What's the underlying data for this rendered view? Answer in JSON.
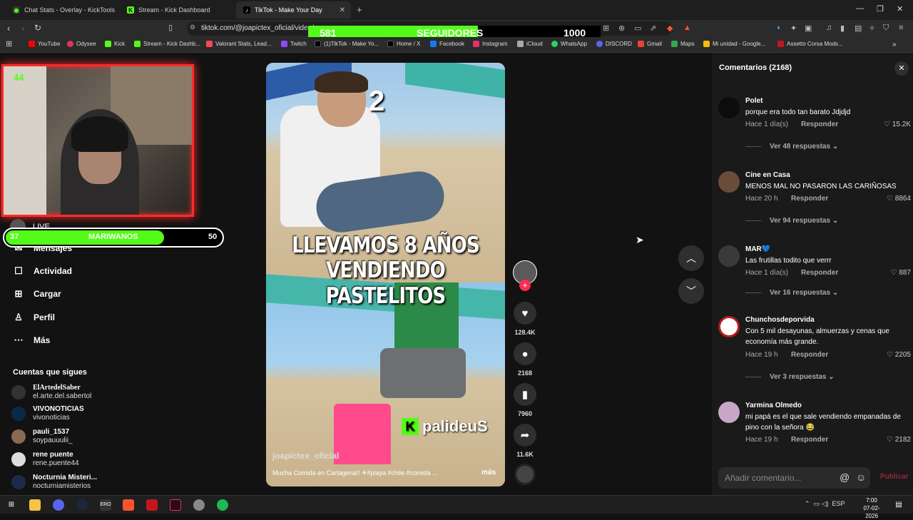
{
  "browser": {
    "tabs": [
      {
        "label": "Chat Stats - Overlay - KickTools",
        "active": false
      },
      {
        "label": "Stream - Kick Dashboard",
        "active": false
      },
      {
        "label": "TikTok - Make Your Day",
        "active": true
      }
    ],
    "url": "tiktok.com/@joapictex_oficial/video/",
    "bookmarks": [
      "YouTube",
      "Odysee",
      "Kick",
      "Stream - Kick Dashb...",
      "Valorant Stats, Lead...",
      "Twitch",
      "(1)TikTok - Make Yo...",
      "Home / X",
      "Facebook",
      "Instagram",
      "iCloud",
      "WhatsApp",
      "DISCORD",
      "Gmail",
      "Maps",
      "Mi unidad - Google...",
      "Assetto Corsa Mods..."
    ]
  },
  "overlay_followers": {
    "current": "581",
    "label": "SEGUIDORES",
    "goal": "1000",
    "progress": 0.58
  },
  "webcam": {
    "count": "44"
  },
  "live_label": "LIVE",
  "overlay_mariwanos": {
    "current": "37",
    "label": "MARIWANOS",
    "goal": "50",
    "progress": 0.74
  },
  "sidebar": {
    "items": [
      {
        "label": "Mensajes",
        "icon": "messages-icon"
      },
      {
        "label": "Actividad",
        "icon": "activity-icon"
      },
      {
        "label": "Cargar",
        "icon": "upload-icon"
      },
      {
        "label": "Perfil",
        "icon": "profile-icon"
      },
      {
        "label": "Más",
        "icon": "more-icon"
      }
    ],
    "following_title": "Cuentas que sigues",
    "following": [
      {
        "name": "ElArtedelSaber",
        "user": "el.arte.del.sabertol"
      },
      {
        "name": "VIVONOTICIAS",
        "user": "vivonoticias"
      },
      {
        "name": "pauli_1537",
        "user": "soypauuulii_"
      },
      {
        "name": "rene puente",
        "user": "rene.puente44"
      },
      {
        "name": "Nocturnia Misteri...",
        "user": "nocturniamisterios"
      }
    ]
  },
  "video": {
    "number": "2",
    "caption_line1": "LLEVAMOS 8 AÑOS",
    "caption_line2": "VENDIENDO PASTELITOS",
    "watermark": "palideuS",
    "username": "joapictex_oficial",
    "description": "Mucha Comida en Cartagena!! ✈#playa #chile #comida ...",
    "more": "más"
  },
  "actions": {
    "likes": "128.4K",
    "comments": "2168",
    "saves": "7960",
    "shares": "11.6K"
  },
  "comments": {
    "title": "Comentarios (2168)",
    "reply_label": "Responder",
    "items": [
      {
        "author": "Polet",
        "text": "porque era todo tan barato Jdjdjd",
        "time": "Hace 1 día(s)",
        "likes": "15.2K",
        "replies": "Ver 48 respuestas"
      },
      {
        "author": "Cine en Casa",
        "text": "MENOS MAL NO PASARON LAS CARIÑOSAS",
        "time": "Hace 20 h",
        "likes": "8864",
        "replies": "Ver 94 respuestas"
      },
      {
        "author": "MAR💙",
        "text": "Las frutillas todito que verrr",
        "time": "Hace 1 día(s)",
        "likes": "887",
        "replies": "Ver 16 respuestas"
      },
      {
        "author": "Chunchosdeporvida",
        "text": "Con 5 mil desayunas, almuerzas y cenas que economía más grande.",
        "time": "Hace 19 h",
        "likes": "2205",
        "replies": "Ver 3 respuestas"
      },
      {
        "author": "Yarmina Olmedo",
        "text": "mi papá es el que sale vendiendo empanadas de pino con la señora 😂",
        "time": "Hace 19 h",
        "likes": "2182",
        "replies": ""
      }
    ],
    "input_placeholder": "Añadir comentario...",
    "publish": "Publicar"
  },
  "taskbar": {
    "lang": "ESP",
    "time": "7:00",
    "date": "07-02-2026"
  }
}
